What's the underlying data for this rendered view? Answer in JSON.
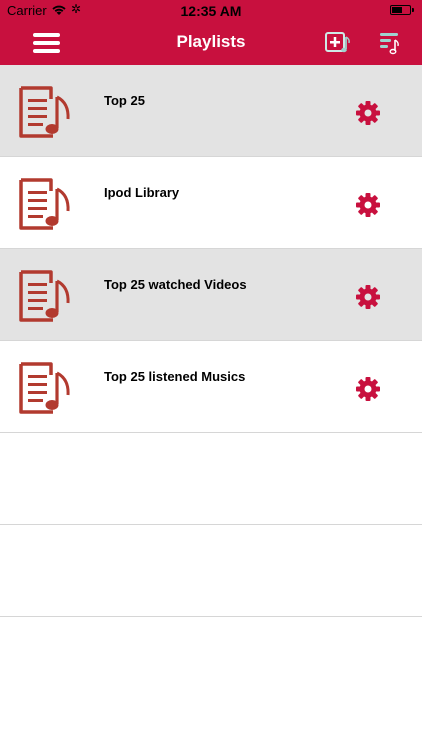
{
  "status": {
    "carrier": "Carrier",
    "time": "12:35 AM",
    "battery_level": 0.6
  },
  "navbar": {
    "title": "Playlists"
  },
  "colors": {
    "brand": "#c8103e",
    "icon_red": "#b23a2f",
    "row_shade": "#e3e3e3",
    "accent_teal": "#9fd3cf"
  },
  "playlists": [
    {
      "title": "Top 25",
      "shaded": true
    },
    {
      "title": "Ipod Library",
      "shaded": false
    },
    {
      "title": "Top 25 watched Videos",
      "shaded": true
    },
    {
      "title": "Top 25 listened Musics",
      "shaded": false
    }
  ]
}
